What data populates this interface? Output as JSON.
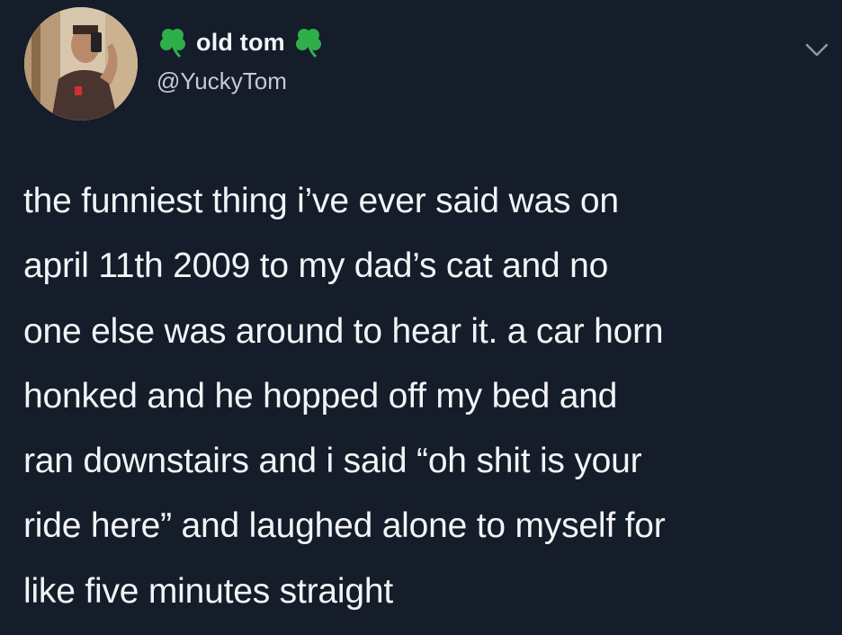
{
  "user": {
    "display_name": "old tom",
    "handle": "@YuckyTom",
    "avatar_icon": "profile-photo",
    "name_emoji": "four-leaf-clover-icon"
  },
  "tweet": {
    "text": "the funniest thing i’ve ever said was on\napril 11th 2009 to my dad’s cat and no\none else was around to hear it. a car horn\nhonked and he hopped off my bed and\nran downstairs and i said “oh shit is your\nride here” and laughed alone to myself for\nlike five minutes straight"
  },
  "colors": {
    "background": "#151c2a",
    "text": "#f2f4f6",
    "secondary_text": "#c4cbd3",
    "clover": "#2faf4a"
  },
  "menu": {
    "icon": "chevron-down-icon"
  }
}
